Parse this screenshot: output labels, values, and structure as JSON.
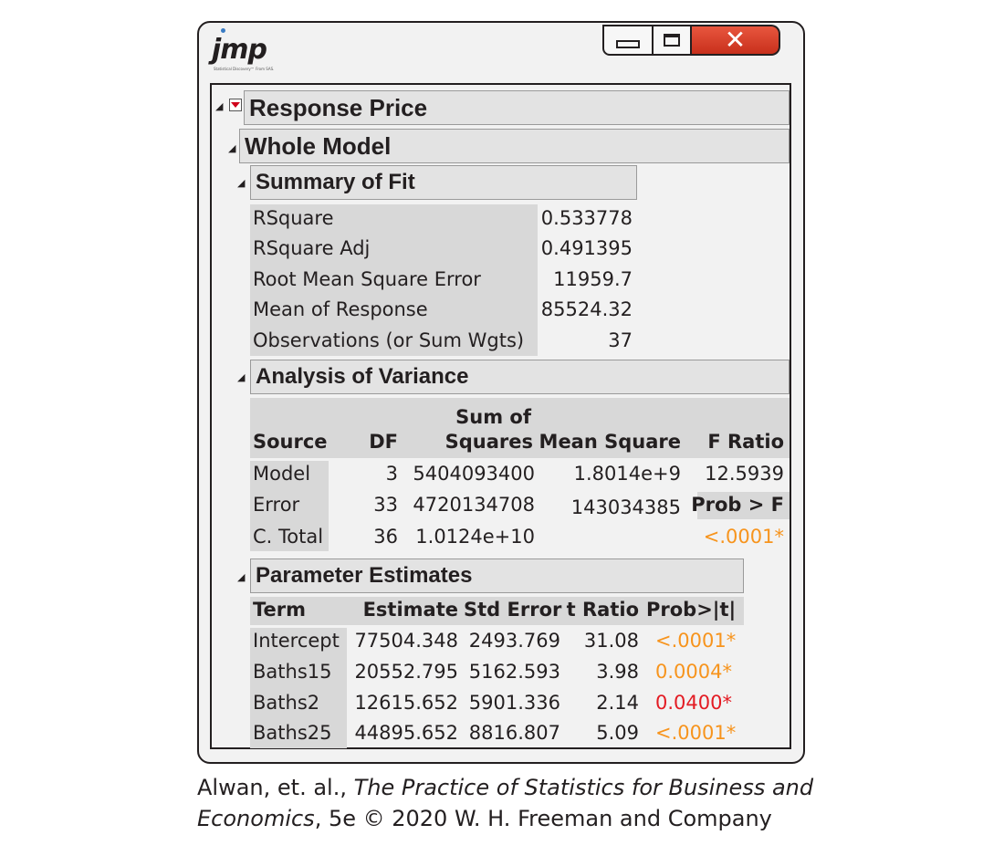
{
  "app": {
    "logo_text": "jmp",
    "logo_sub": "Statistical Discovery™ From SAS."
  },
  "window_buttons": {
    "minimize": "minimize",
    "maximize": "maximize",
    "close": "✕"
  },
  "report": {
    "response_title": "Response Price",
    "whole_model_title": "Whole Model",
    "summary_of_fit": {
      "title": "Summary of Fit",
      "rows": [
        {
          "label": "RSquare",
          "value": "0.533778"
        },
        {
          "label": "RSquare Adj",
          "value": "0.491395"
        },
        {
          "label": "Root Mean Square Error",
          "value": "11959.7"
        },
        {
          "label": "Mean of Response",
          "value": "85524.32"
        },
        {
          "label": "Observations (or Sum Wgts)",
          "value": "37"
        }
      ]
    },
    "anova": {
      "title": "Analysis of Variance",
      "headers": {
        "source": "Source",
        "df": "DF",
        "ss_top": "Sum of",
        "ss_bottom": "Squares",
        "ms": "Mean Square",
        "f": "F Ratio"
      },
      "rows": [
        {
          "source": "Model",
          "df": "3",
          "ss": "5404093400",
          "ms": "1.8014e+9",
          "f": "12.5939"
        },
        {
          "source": "Error",
          "df": "33",
          "ss": "4720134708",
          "ms": "143034385",
          "f": "Prob > F"
        },
        {
          "source": "C. Total",
          "df": "36",
          "ss": "1.0124e+10",
          "ms": "",
          "f": "<.0001*"
        }
      ]
    },
    "parameter_estimates": {
      "title": "Parameter Estimates",
      "headers": {
        "term": "Term",
        "estimate": "Estimate",
        "std_error": "Std Error",
        "t_ratio": "t Ratio",
        "prob": "Prob>|t|"
      },
      "rows": [
        {
          "term": "Intercept",
          "estimate": "77504.348",
          "std_error": "2493.769",
          "t_ratio": "31.08",
          "prob": "<.0001*"
        },
        {
          "term": "Baths15",
          "estimate": "20552.795",
          "std_error": "5162.593",
          "t_ratio": "3.98",
          "prob": "0.0004*"
        },
        {
          "term": "Baths2",
          "estimate": "12615.652",
          "std_error": "5901.336",
          "t_ratio": "2.14",
          "prob": "0.0400*"
        },
        {
          "term": "Baths25",
          "estimate": "44895.652",
          "std_error": "8816.807",
          "t_ratio": "5.09",
          "prob": "<.0001*"
        }
      ]
    }
  },
  "caption": {
    "line1_plain": "Alwan, et. al., ",
    "line1_italic": "The Practice of Statistics for Business and",
    "line2_italic": "Economics",
    "line2_plain": ", 5e © 2020 W. H. Freeman and Company"
  },
  "colors": {
    "significant_orange": "#f7941d",
    "significant_red": "#e31b23",
    "close_button": "#d9402a"
  }
}
